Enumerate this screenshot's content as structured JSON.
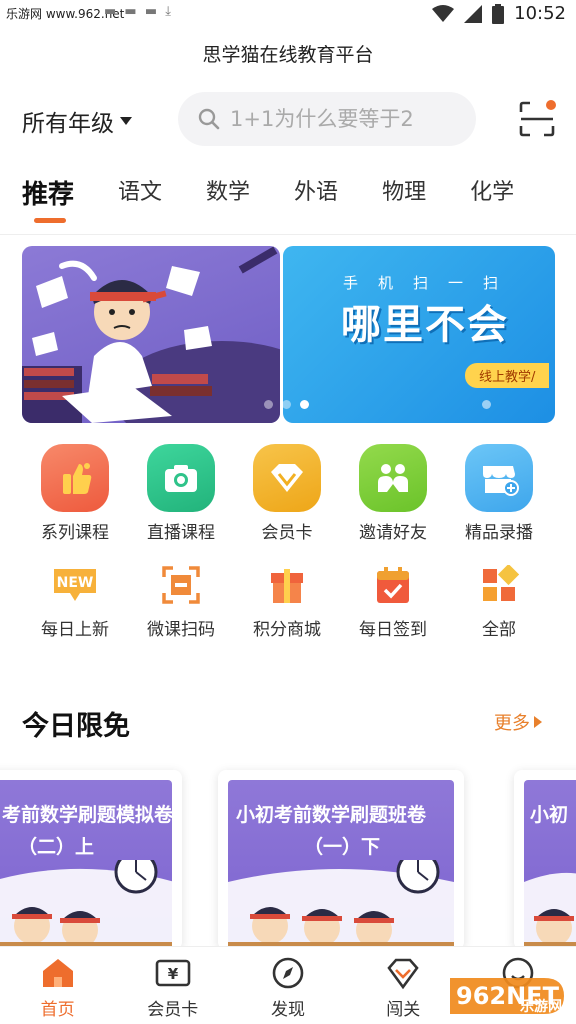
{
  "status_bar": {
    "watermark_text": "乐游网 www.962.net",
    "time": "10:52",
    "wifi_icon": "wifi-icon",
    "signal_icon": "signal-icon",
    "battery_icon": "battery-icon"
  },
  "app": {
    "title": "思学猫在线教育平台"
  },
  "top_bar": {
    "grade": "所有年级",
    "search_placeholder": "1+1为什么要等于2",
    "scan_icon": "scan-icon",
    "accent_color": "#ee6d2d"
  },
  "tabs": [
    {
      "label": "推荐",
      "active": true
    },
    {
      "label": "语文"
    },
    {
      "label": "数学"
    },
    {
      "label": "外语"
    },
    {
      "label": "物理"
    },
    {
      "label": "化学"
    }
  ],
  "banners": [
    {
      "id": "exam-student"
    },
    {
      "top_text": "手机扫一扫",
      "main_text": "哪里不会",
      "tag": "线上教学/"
    }
  ],
  "carousel": {
    "count": 3,
    "active_index": 2
  },
  "grid": [
    {
      "label": "系列课程",
      "icon": "thumbs-up-icon",
      "color": "#f26b4f"
    },
    {
      "label": "直播课程",
      "icon": "camera-icon",
      "color": "#2fc38a"
    },
    {
      "label": "会员卡",
      "icon": "diamond-icon",
      "color": "#f2b022"
    },
    {
      "label": "邀请好友",
      "icon": "friends-icon",
      "color": "#7fcf3a"
    },
    {
      "label": "精品录播",
      "icon": "store-icon",
      "color": "#4fb3f2"
    },
    {
      "label": "每日上新",
      "icon": "new-icon",
      "color": "#f5a623"
    },
    {
      "label": "微课扫码",
      "icon": "qr-scan-icon",
      "color": "#f08a3a"
    },
    {
      "label": "积分商城",
      "icon": "gift-icon",
      "color": "#f0643c"
    },
    {
      "label": "每日签到",
      "icon": "calendar-check-icon",
      "color": "#f05a3c"
    },
    {
      "label": "全部",
      "icon": "all-apps-icon",
      "color": "#f0a030"
    }
  ],
  "section": {
    "title": "今日限免",
    "more": "更多"
  },
  "cards": [
    {
      "title_line1": "考前数学刷题模拟卷",
      "title_line2": "（二）上"
    },
    {
      "title_line1": "小初考前数学刷题班卷",
      "title_line2": "（一）下"
    },
    {
      "title_line1": "小初"
    }
  ],
  "bottom_nav": [
    {
      "label": "首页",
      "icon": "home-icon",
      "active": true
    },
    {
      "label": "会员卡",
      "icon": "member-card-icon"
    },
    {
      "label": "发现",
      "icon": "compass-icon"
    },
    {
      "label": "闯关",
      "icon": "level-icon"
    },
    {
      "label": "",
      "icon": "profile-icon"
    }
  ],
  "watermark": {
    "text": "乐游网",
    "brand": "962NET"
  }
}
